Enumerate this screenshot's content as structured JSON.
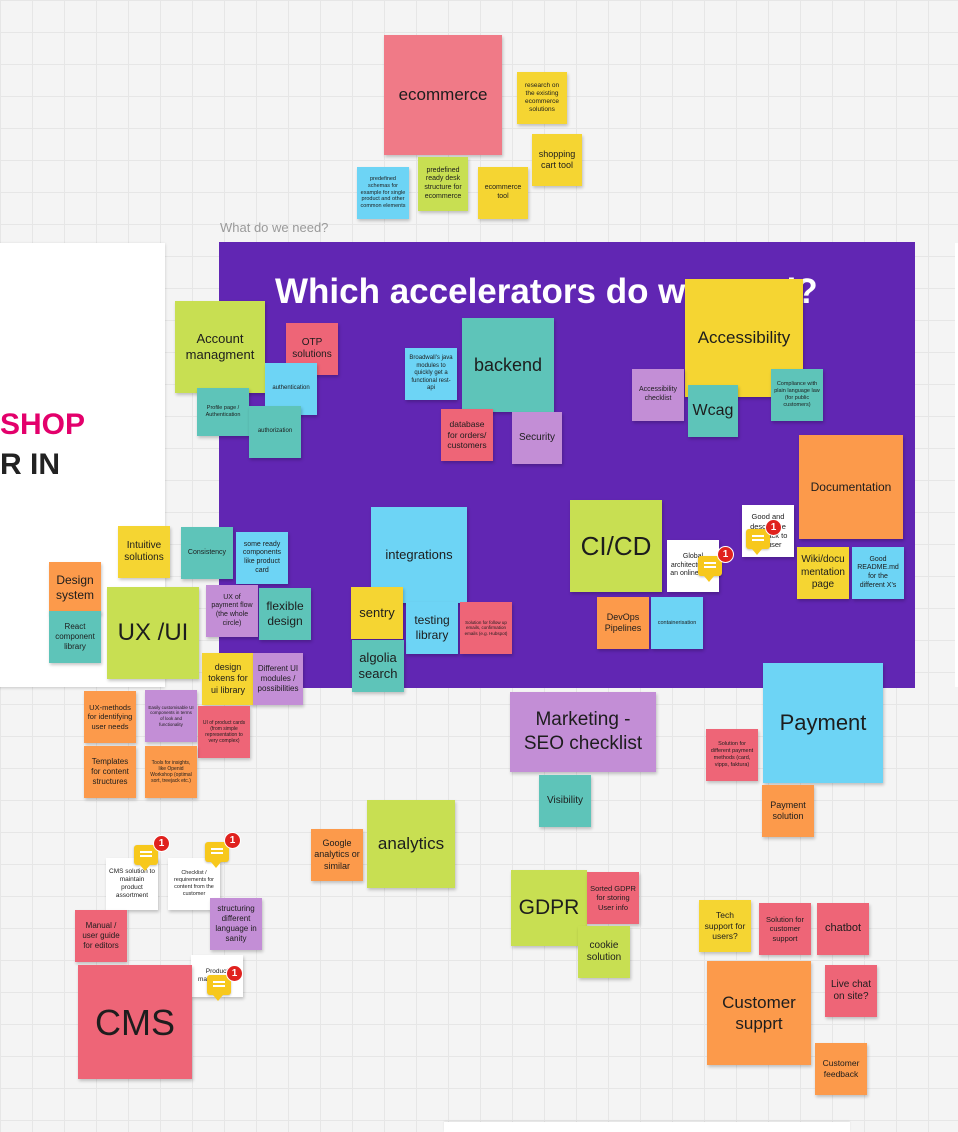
{
  "colors": {
    "purple_frame": "#6126b3",
    "pink": "#f07a87",
    "yellow": "#f5d532",
    "lime": "#c8df52",
    "teal": "#5ec4b9",
    "blue": "#6dd4f5",
    "orange": "#fc9a4b",
    "violet": "#c38ed6",
    "red": "#ee6577",
    "white": "#ffffff",
    "shop_text": "#e3006b"
  },
  "frame": {
    "label": "What do we need?",
    "title": "Which accelerators do we need?"
  },
  "white_doc": {
    "line1": "SHOP",
    "line2": "R IN"
  },
  "comment_icon": "comment-icon",
  "comment_badge_count": "1",
  "notes": [
    {
      "text": "ecommerce",
      "color": "pink"
    },
    {
      "text": "research on the existing ecommerce solutions",
      "color": "yellow"
    },
    {
      "text": "shopping cart tool",
      "color": "yellow"
    },
    {
      "text": "predefined schemas for example for single product and other common elements",
      "color": "blue"
    },
    {
      "text": "predefined ready desk structure for ecommerce",
      "color": "lime"
    },
    {
      "text": "ecommerce tool",
      "color": "yellow"
    },
    {
      "text": "Account managment",
      "color": "lime"
    },
    {
      "text": "OTP solutions",
      "color": "red"
    },
    {
      "text": "authentication",
      "color": "blue"
    },
    {
      "text": "Profile page / Authentication",
      "color": "teal"
    },
    {
      "text": "authorization",
      "color": "teal"
    },
    {
      "text": "Broadwall's java modules to quickly get a functional rest-api",
      "color": "blue"
    },
    {
      "text": "backend",
      "color": "teal"
    },
    {
      "text": "database for orders/ customers",
      "color": "red"
    },
    {
      "text": "Security",
      "color": "violet"
    },
    {
      "text": "Accessibility",
      "color": "yellow"
    },
    {
      "text": "Accessibility checklist",
      "color": "violet"
    },
    {
      "text": "Wcag",
      "color": "teal"
    },
    {
      "text": "Compliance with plain language law (for public customers)",
      "color": "teal"
    },
    {
      "text": "Documentation",
      "color": "orange"
    },
    {
      "text": "Good and descriptive feedback to the user",
      "color": "white"
    },
    {
      "text": "Wiki/documentation page",
      "color": "yellow"
    },
    {
      "text": "Good README.md for the different X's",
      "color": "blue"
    },
    {
      "text": "integrations",
      "color": "blue"
    },
    {
      "text": "sentry",
      "color": "yellow"
    },
    {
      "text": "testing library",
      "color": "blue"
    },
    {
      "text": "Solution for follow up emails, confirmation emails (e.g. Hubspot)",
      "color": "red"
    },
    {
      "text": "algolia search",
      "color": "teal"
    },
    {
      "text": "CI/CD",
      "color": "lime"
    },
    {
      "text": "Global architecture of an online shop",
      "color": "white"
    },
    {
      "text": "DevOps Pipelines",
      "color": "orange"
    },
    {
      "text": "containerisation",
      "color": "blue"
    },
    {
      "text": "Intuitive solutions",
      "color": "yellow"
    },
    {
      "text": "Consistency",
      "color": "teal"
    },
    {
      "text": "some ready components like product card",
      "color": "blue"
    },
    {
      "text": "Design system",
      "color": "orange"
    },
    {
      "text": "React component library",
      "color": "teal"
    },
    {
      "text": "UX /UI",
      "color": "lime"
    },
    {
      "text": "UX of payment flow (the whole circle)",
      "color": "violet"
    },
    {
      "text": "flexible design",
      "color": "teal"
    },
    {
      "text": "design tokens for ui library",
      "color": "yellow"
    },
    {
      "text": "Different UI modules / possibilities",
      "color": "violet"
    },
    {
      "text": "UX-methods for identifying user needs",
      "color": "orange"
    },
    {
      "text": "Easily customisable UI components in terms of look and functionality",
      "color": "violet"
    },
    {
      "text": "UI of product cards (from simple representation to very complex)",
      "color": "red"
    },
    {
      "text": "Templates for content structures",
      "color": "orange"
    },
    {
      "text": "Tools for insights, like Openid Workshop (optimal sort, treejack etc.)",
      "color": "orange"
    },
    {
      "text": "Marketing - SEO checklist",
      "color": "violet"
    },
    {
      "text": "Visibility",
      "color": "teal"
    },
    {
      "text": "Payment",
      "color": "blue"
    },
    {
      "text": "Solution for different payment methods (card, vipps, faktura)",
      "color": "red"
    },
    {
      "text": "Payment solution",
      "color": "orange"
    },
    {
      "text": "Google analytics or similar",
      "color": "orange"
    },
    {
      "text": "analytics",
      "color": "lime"
    },
    {
      "text": "CMS solution to maintain product assortment",
      "color": "white"
    },
    {
      "text": "Checklist / requirements for content from the customer",
      "color": "white"
    },
    {
      "text": "structuring different language in sanity",
      "color": "violet"
    },
    {
      "text": "Manual / user guide for editors",
      "color": "red"
    },
    {
      "text": "Product management",
      "color": "white"
    },
    {
      "text": "CMS",
      "color": "red"
    },
    {
      "text": "GDPR",
      "color": "lime"
    },
    {
      "text": "Sorted GDPR for storing User info",
      "color": "red"
    },
    {
      "text": "cookie solution",
      "color": "lime"
    },
    {
      "text": "Tech support for users?",
      "color": "yellow"
    },
    {
      "text": "Solution for customer support",
      "color": "red"
    },
    {
      "text": "chatbot",
      "color": "red"
    },
    {
      "text": "Customer supprt",
      "color": "orange"
    },
    {
      "text": "Live chat on site?",
      "color": "red"
    },
    {
      "text": "Customer feedback",
      "color": "orange"
    }
  ]
}
